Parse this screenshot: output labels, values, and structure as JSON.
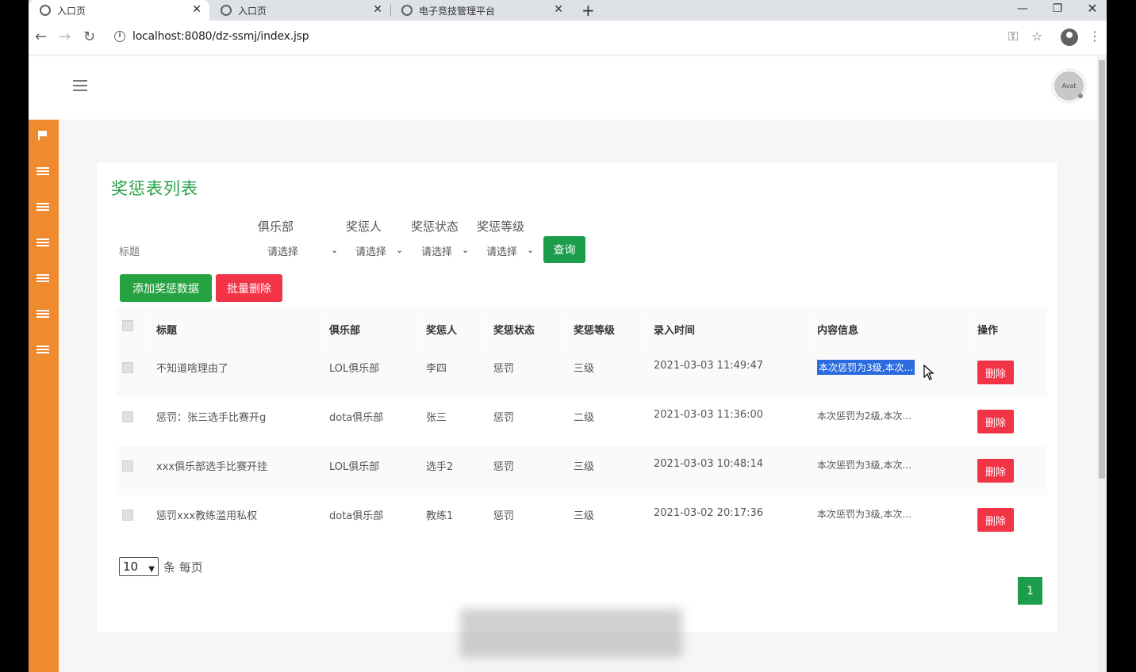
{
  "browser": {
    "tabs": [
      {
        "title": "入口页"
      },
      {
        "title": "入口页"
      },
      {
        "title": "电子竞技管理平台"
      }
    ],
    "url": "localhost:8080/dz-ssmj/index.jsp"
  },
  "header": {
    "avatar_text": "Avat"
  },
  "page": {
    "title": "奖惩表列表"
  },
  "filters": {
    "title_placeholder": "标题",
    "labels": {
      "club": "俱乐部",
      "person": "奖惩人",
      "status": "奖惩状态",
      "level": "奖惩等级"
    },
    "select_value": "请选择",
    "query_label": "查询"
  },
  "actions": {
    "add_label": "添加奖惩数据",
    "batch_delete_label": "批量删除"
  },
  "table": {
    "headers": [
      "标题",
      "俱乐部",
      "奖惩人",
      "奖惩状态",
      "奖惩等级",
      "录入时间",
      "内容信息",
      "操作"
    ],
    "rows": [
      {
        "title": "不知道啥理由了",
        "club": "LOL俱乐部",
        "person": "李四",
        "status": "惩罚",
        "level": "三级",
        "time": "2021-03-03 11:49:47",
        "content": "本次惩罚为3级,本次...",
        "action": "删除"
      },
      {
        "title": "惩罚：张三选手比赛开g",
        "club": "dota俱乐部",
        "person": "张三",
        "status": "惩罚",
        "level": "二级",
        "time": "2021-03-03 11:36:00",
        "content": "本次惩罚为2级,本次...",
        "action": "删除"
      },
      {
        "title": "xxx俱乐部选手比赛开挂",
        "club": "LOL俱乐部",
        "person": "选手2",
        "status": "惩罚",
        "level": "三级",
        "time": "2021-03-03 10:48:14",
        "content": "本次惩罚为3级,本次...",
        "action": "删除"
      },
      {
        "title": "惩罚xxx教练滥用私权",
        "club": "dota俱乐部",
        "person": "教练1",
        "status": "惩罚",
        "level": "三级",
        "time": "2021-03-02 20:17:36",
        "content": "本次惩罚为3级,本次...",
        "action": "删除"
      }
    ]
  },
  "pagination": {
    "page_size": "10",
    "per_page_label": "条 每页",
    "current_page": "1"
  },
  "colors": {
    "sidebar": "#f08a2e",
    "primary": "#1c9d4c",
    "danger": "#f33446",
    "title_green": "#26a146"
  },
  "icons": [
    "flag-icon",
    "list-icon",
    "menu-icon",
    "avatar-icon",
    "key-icon",
    "star-icon",
    "account-icon"
  ]
}
